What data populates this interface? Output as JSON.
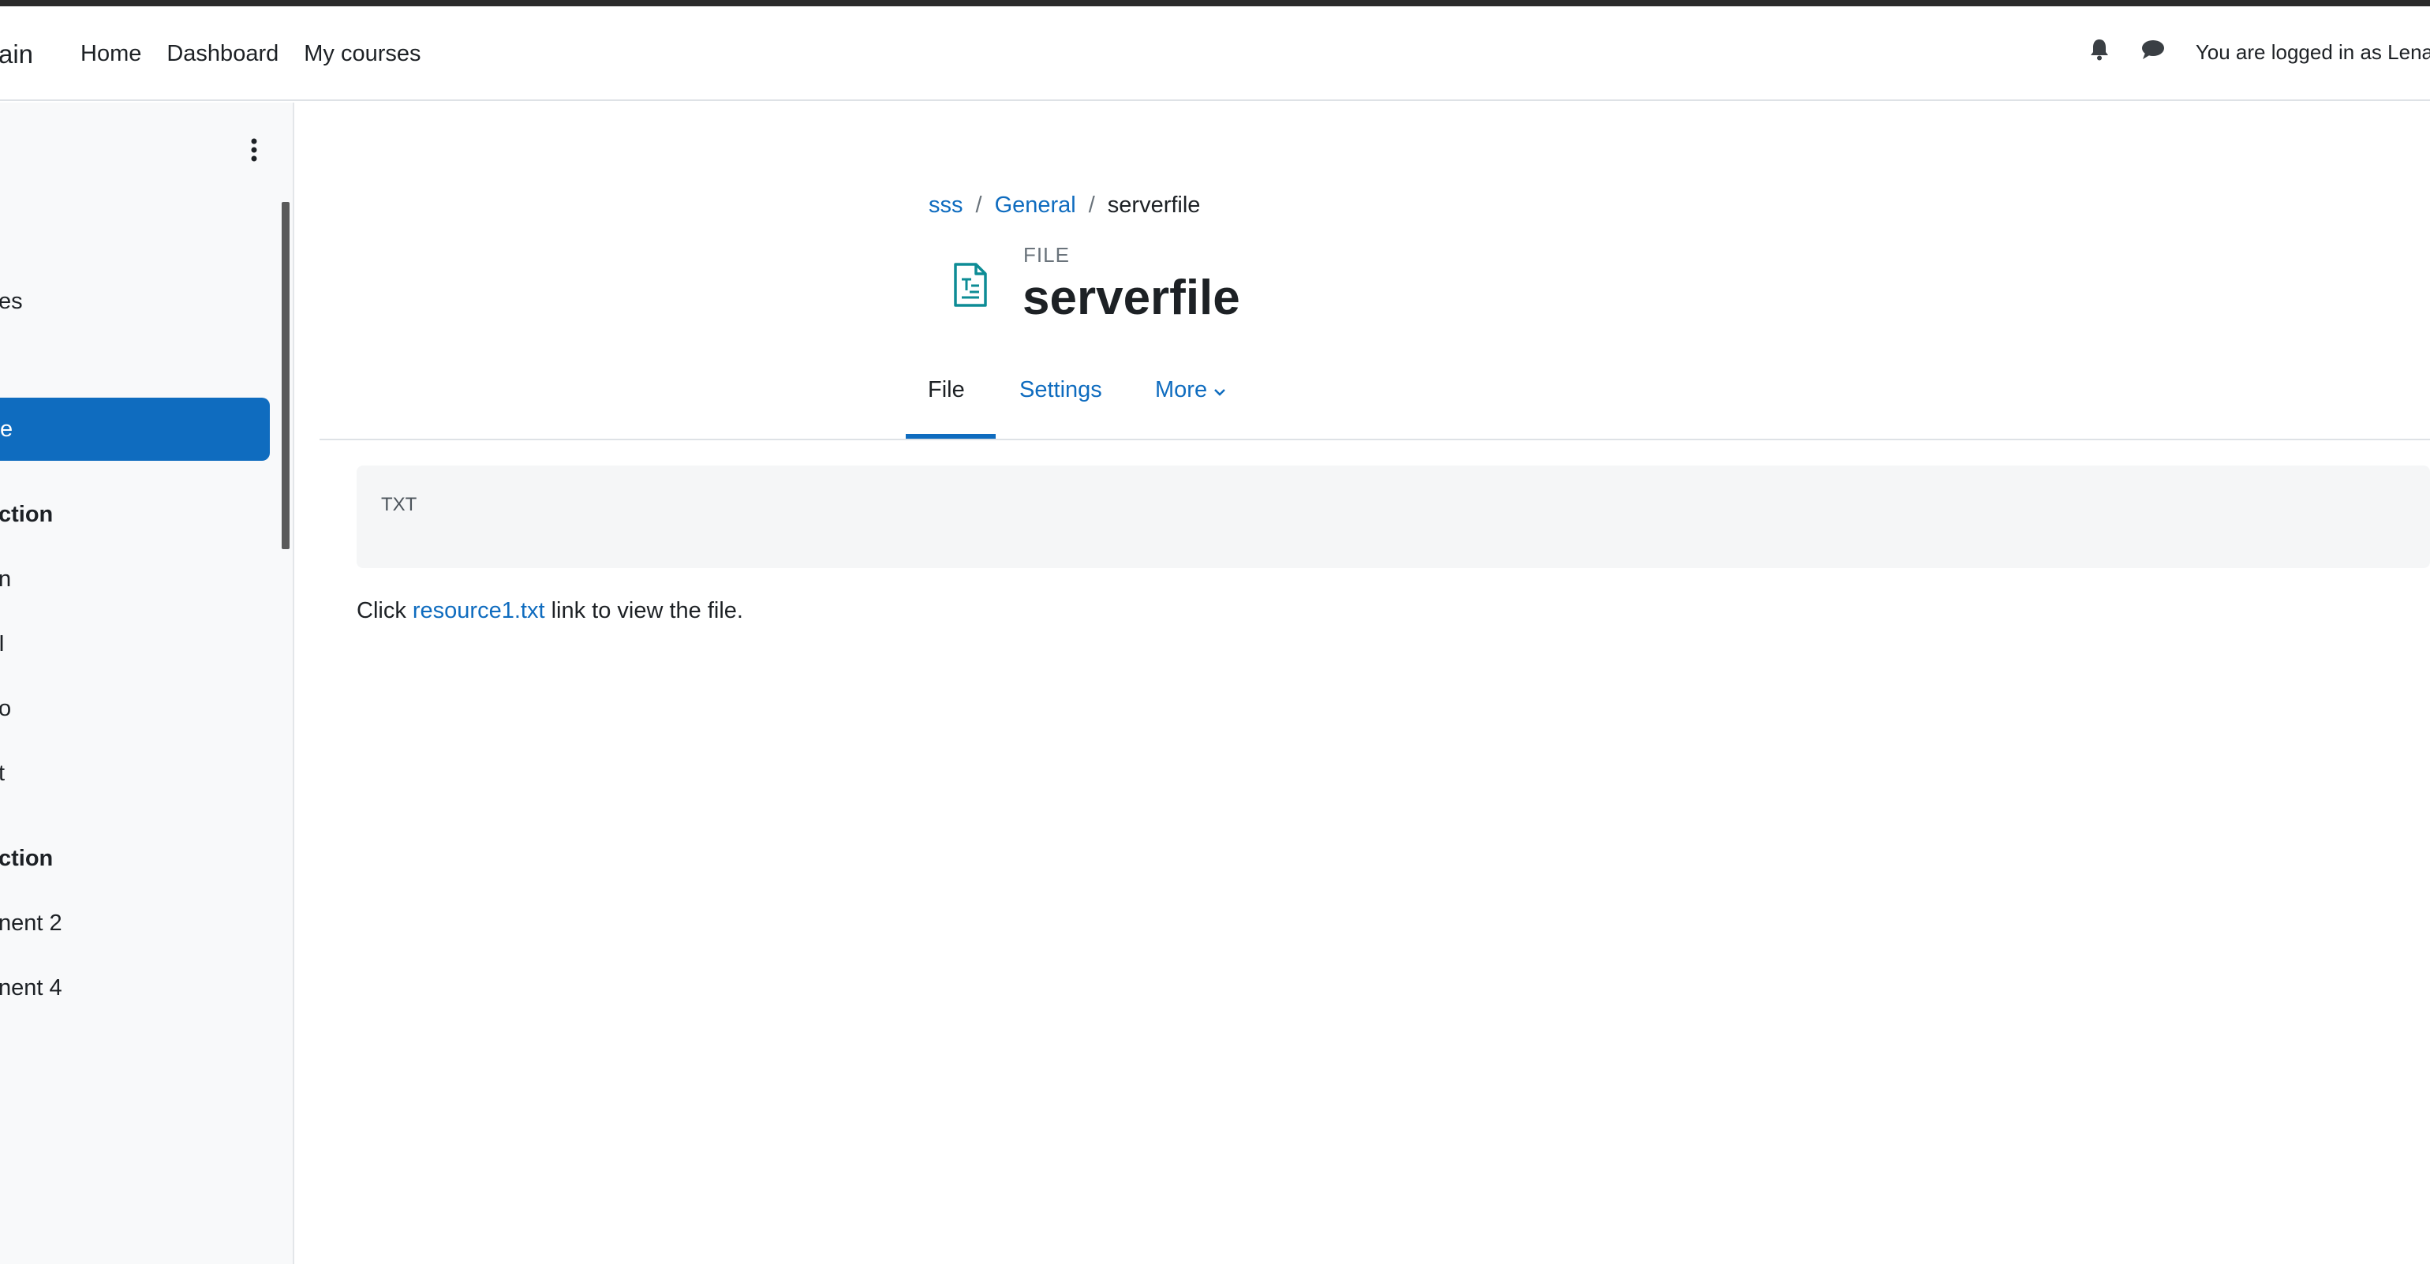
{
  "navbar": {
    "brand": "ain",
    "links": [
      "Home",
      "Dashboard",
      "My courses"
    ],
    "login_text": "You are logged in as Lena"
  },
  "drawer": {
    "items": [
      {
        "label": "es",
        "bold": false
      },
      {
        "label": "e",
        "active": true
      },
      {
        "label": "ction",
        "bold": true
      },
      {
        "label": "n",
        "bold": false
      },
      {
        "label": "I",
        "bold": false
      },
      {
        "label": "o",
        "bold": false
      },
      {
        "label": "t",
        "bold": false
      },
      {
        "label": "ction",
        "bold": true
      },
      {
        "label": "nent 2",
        "bold": false
      },
      {
        "label": "nent 4",
        "bold": false
      }
    ]
  },
  "breadcrumb": {
    "items": [
      "sss",
      "General",
      "serverfile"
    ],
    "separator": "/"
  },
  "header": {
    "kicker": "FILE",
    "title": "serverfile"
  },
  "tabs": [
    {
      "label": "File",
      "active": true
    },
    {
      "label": "Settings",
      "active": false
    },
    {
      "label": "More",
      "active": false
    }
  ],
  "file": {
    "type_label": "TXT",
    "text_before": "Click ",
    "link_text": "resource1.txt",
    "text_after": " link to view the file."
  },
  "colors": {
    "accent": "#0f6cbf",
    "icon_teal": "#0d8c95",
    "drawer_bg": "#f8f9fa"
  },
  "icons": [
    "bell-icon",
    "chat-icon",
    "kebab-icon",
    "text-file-icon",
    "chevron-down-icon"
  ]
}
